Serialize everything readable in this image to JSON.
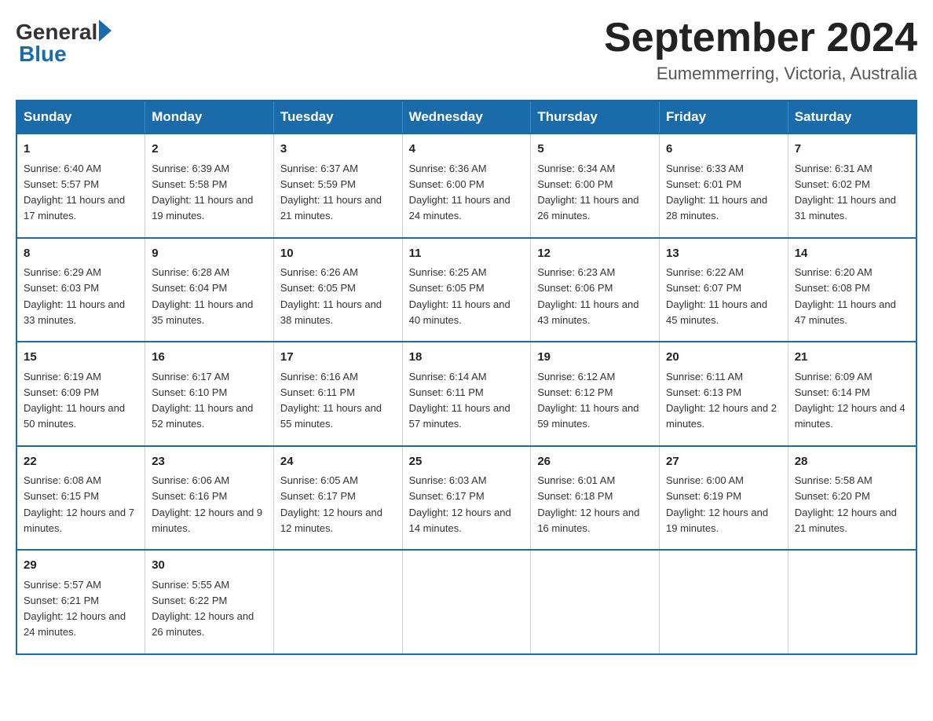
{
  "header": {
    "logo_general": "General",
    "logo_blue": "Blue",
    "month_title": "September 2024",
    "location": "Eumemmerring, Victoria, Australia"
  },
  "calendar": {
    "days_of_week": [
      "Sunday",
      "Monday",
      "Tuesday",
      "Wednesday",
      "Thursday",
      "Friday",
      "Saturday"
    ],
    "weeks": [
      [
        {
          "day": "1",
          "sunrise": "6:40 AM",
          "sunset": "5:57 PM",
          "daylight": "11 hours and 17 minutes."
        },
        {
          "day": "2",
          "sunrise": "6:39 AM",
          "sunset": "5:58 PM",
          "daylight": "11 hours and 19 minutes."
        },
        {
          "day": "3",
          "sunrise": "6:37 AM",
          "sunset": "5:59 PM",
          "daylight": "11 hours and 21 minutes."
        },
        {
          "day": "4",
          "sunrise": "6:36 AM",
          "sunset": "6:00 PM",
          "daylight": "11 hours and 24 minutes."
        },
        {
          "day": "5",
          "sunrise": "6:34 AM",
          "sunset": "6:00 PM",
          "daylight": "11 hours and 26 minutes."
        },
        {
          "day": "6",
          "sunrise": "6:33 AM",
          "sunset": "6:01 PM",
          "daylight": "11 hours and 28 minutes."
        },
        {
          "day": "7",
          "sunrise": "6:31 AM",
          "sunset": "6:02 PM",
          "daylight": "11 hours and 31 minutes."
        }
      ],
      [
        {
          "day": "8",
          "sunrise": "6:29 AM",
          "sunset": "6:03 PM",
          "daylight": "11 hours and 33 minutes."
        },
        {
          "day": "9",
          "sunrise": "6:28 AM",
          "sunset": "6:04 PM",
          "daylight": "11 hours and 35 minutes."
        },
        {
          "day": "10",
          "sunrise": "6:26 AM",
          "sunset": "6:05 PM",
          "daylight": "11 hours and 38 minutes."
        },
        {
          "day": "11",
          "sunrise": "6:25 AM",
          "sunset": "6:05 PM",
          "daylight": "11 hours and 40 minutes."
        },
        {
          "day": "12",
          "sunrise": "6:23 AM",
          "sunset": "6:06 PM",
          "daylight": "11 hours and 43 minutes."
        },
        {
          "day": "13",
          "sunrise": "6:22 AM",
          "sunset": "6:07 PM",
          "daylight": "11 hours and 45 minutes."
        },
        {
          "day": "14",
          "sunrise": "6:20 AM",
          "sunset": "6:08 PM",
          "daylight": "11 hours and 47 minutes."
        }
      ],
      [
        {
          "day": "15",
          "sunrise": "6:19 AM",
          "sunset": "6:09 PM",
          "daylight": "11 hours and 50 minutes."
        },
        {
          "day": "16",
          "sunrise": "6:17 AM",
          "sunset": "6:10 PM",
          "daylight": "11 hours and 52 minutes."
        },
        {
          "day": "17",
          "sunrise": "6:16 AM",
          "sunset": "6:11 PM",
          "daylight": "11 hours and 55 minutes."
        },
        {
          "day": "18",
          "sunrise": "6:14 AM",
          "sunset": "6:11 PM",
          "daylight": "11 hours and 57 minutes."
        },
        {
          "day": "19",
          "sunrise": "6:12 AM",
          "sunset": "6:12 PM",
          "daylight": "11 hours and 59 minutes."
        },
        {
          "day": "20",
          "sunrise": "6:11 AM",
          "sunset": "6:13 PM",
          "daylight": "12 hours and 2 minutes."
        },
        {
          "day": "21",
          "sunrise": "6:09 AM",
          "sunset": "6:14 PM",
          "daylight": "12 hours and 4 minutes."
        }
      ],
      [
        {
          "day": "22",
          "sunrise": "6:08 AM",
          "sunset": "6:15 PM",
          "daylight": "12 hours and 7 minutes."
        },
        {
          "day": "23",
          "sunrise": "6:06 AM",
          "sunset": "6:16 PM",
          "daylight": "12 hours and 9 minutes."
        },
        {
          "day": "24",
          "sunrise": "6:05 AM",
          "sunset": "6:17 PM",
          "daylight": "12 hours and 12 minutes."
        },
        {
          "day": "25",
          "sunrise": "6:03 AM",
          "sunset": "6:17 PM",
          "daylight": "12 hours and 14 minutes."
        },
        {
          "day": "26",
          "sunrise": "6:01 AM",
          "sunset": "6:18 PM",
          "daylight": "12 hours and 16 minutes."
        },
        {
          "day": "27",
          "sunrise": "6:00 AM",
          "sunset": "6:19 PM",
          "daylight": "12 hours and 19 minutes."
        },
        {
          "day": "28",
          "sunrise": "5:58 AM",
          "sunset": "6:20 PM",
          "daylight": "12 hours and 21 minutes."
        }
      ],
      [
        {
          "day": "29",
          "sunrise": "5:57 AM",
          "sunset": "6:21 PM",
          "daylight": "12 hours and 24 minutes."
        },
        {
          "day": "30",
          "sunrise": "5:55 AM",
          "sunset": "6:22 PM",
          "daylight": "12 hours and 26 minutes."
        },
        null,
        null,
        null,
        null,
        null
      ]
    ]
  }
}
